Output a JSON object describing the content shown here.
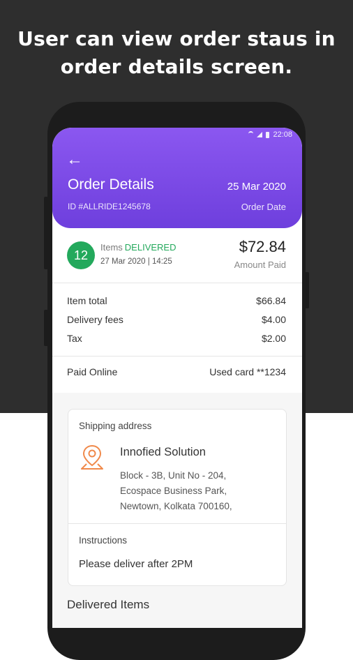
{
  "caption": {
    "line1": "User can view order staus in",
    "line2": "order details screen."
  },
  "status_bar": {
    "time": "22:08",
    "icons": [
      "wifi-icon",
      "signal-icon",
      "battery-icon"
    ]
  },
  "header": {
    "back_icon": "arrow-left-icon",
    "title": "Order Details",
    "order_id": "ID #ALLRIDE1245678",
    "date": "25 Mar 2020",
    "date_label": "Order Date"
  },
  "summary": {
    "item_count": "12",
    "items_label": "Items",
    "status": "DELIVERED",
    "delivered_at": "27 Mar 2020 | 14:25",
    "amount": "$72.84",
    "amount_label": "Amount Paid"
  },
  "price_breakdown": [
    {
      "label": "Item total",
      "value": "$66.84"
    },
    {
      "label": "Delivery fees",
      "value": "$4.00"
    },
    {
      "label": "Tax",
      "value": "$2.00"
    }
  ],
  "payment": {
    "method": "Paid Online",
    "card": "Used card **1234"
  },
  "shipping": {
    "heading": "Shipping address",
    "icon": "location-pin-icon",
    "name": "Innofied Solution",
    "address_lines": [
      "Block - 3B, Unit No - 204,",
      "Ecospace Business Park,",
      "Newtown, Kolkata 700160,"
    ],
    "instructions_heading": "Instructions",
    "instructions": "Please deliver after 2PM"
  },
  "section_title": "Delivered Items",
  "colors": {
    "background_dark": "#2e2e2e",
    "header_purple_top": "#8b57f0",
    "header_purple_bottom": "#6e3fdd",
    "delivered_green": "#23a95c",
    "pin_orange": "#f0894a"
  }
}
